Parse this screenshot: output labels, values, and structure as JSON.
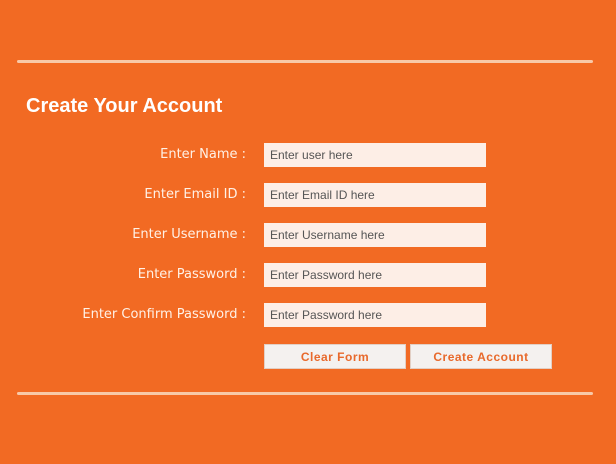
{
  "form": {
    "title": "Create Your Account",
    "fields": [
      {
        "label": "Enter Name :",
        "placeholder": "Enter user here",
        "value": ""
      },
      {
        "label": "Enter Email ID :",
        "placeholder": "Enter Email ID here",
        "value": ""
      },
      {
        "label": "Enter Username :",
        "placeholder": "Enter Username here",
        "value": ""
      },
      {
        "label": "Enter Password :",
        "placeholder": "Enter Password here",
        "value": ""
      },
      {
        "label": "Enter Confirm Password :",
        "placeholder": "Enter Password here",
        "value": ""
      }
    ],
    "buttons": {
      "clear_label": "Clear Form",
      "create_label": "Create Account"
    }
  },
  "colors": {
    "background": "#f26a23",
    "input_background": "#fdeee6",
    "button_text": "#e8692b"
  }
}
